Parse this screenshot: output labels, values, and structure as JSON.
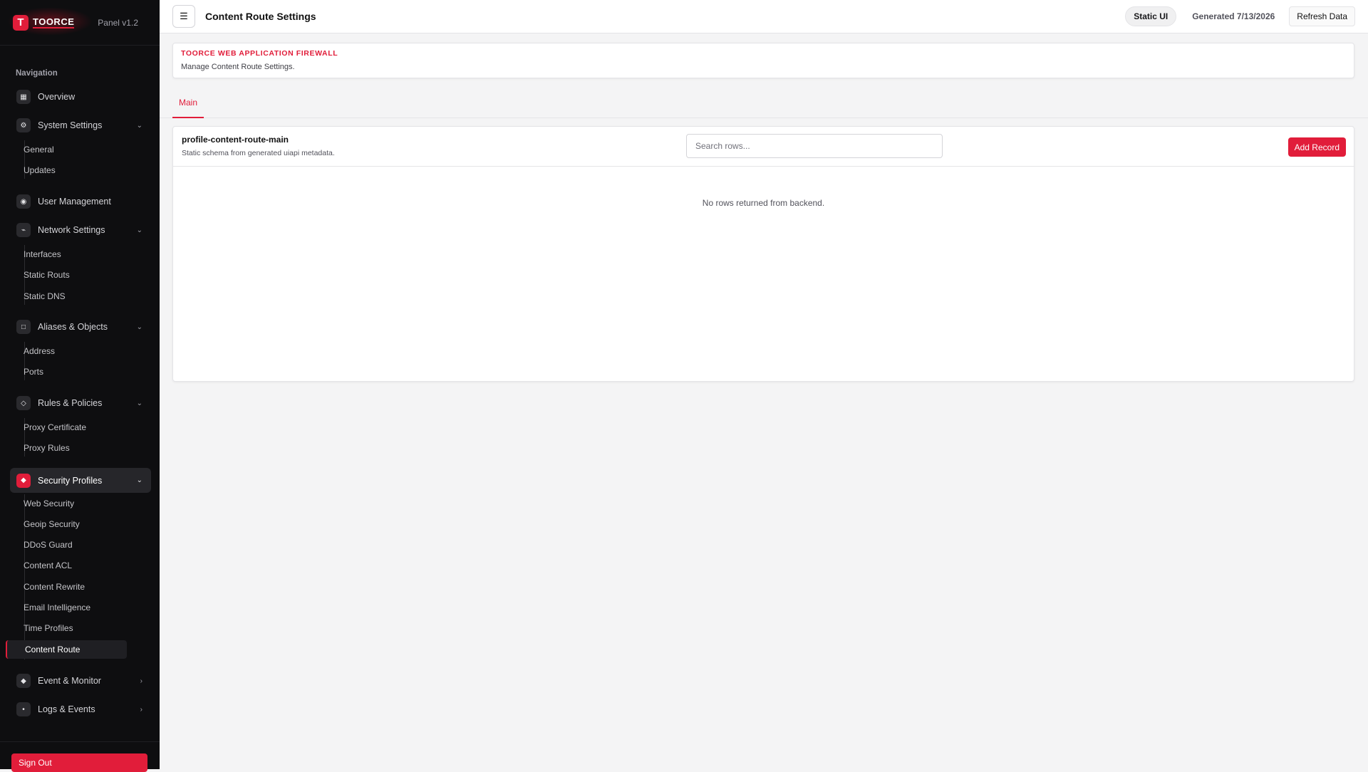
{
  "brand": {
    "logo_letter": "T",
    "name": "TOORCE",
    "version": "Panel v1.2"
  },
  "nav_title": "Navigation",
  "nav": {
    "overview": {
      "label": "Overview",
      "icon": "grid-icon"
    },
    "system_settings": {
      "label": "System Settings",
      "icon": "gear-icon",
      "children": [
        "General",
        "Updates"
      ]
    },
    "user_management": {
      "label": "User Management",
      "icon": "user-icon"
    },
    "network_settings": {
      "label": "Network Settings",
      "icon": "network-icon",
      "children": [
        "Interfaces",
        "Static Routs",
        "Static DNS"
      ]
    },
    "aliases_objects": {
      "label": "Aliases & Objects",
      "icon": "box-icon",
      "children": [
        "Address",
        "Ports"
      ]
    },
    "rules_policies": {
      "label": "Rules & Policies",
      "icon": "diamond-icon",
      "children": [
        "Proxy Certificate",
        "Proxy Rules"
      ]
    },
    "security_profiles": {
      "label": "Security Profiles",
      "icon": "shield-icon",
      "children": [
        "Web Security",
        "Geoip Security",
        "DDoS Guard",
        "Content ACL",
        "Content Rewrite",
        "Email Intelligence",
        "Time Profiles",
        "Content Route"
      ],
      "active_child": "Content Route"
    },
    "event_monitor": {
      "label": "Event & Monitor",
      "icon": "monitor-icon"
    },
    "logs_events": {
      "label": "Logs & Events",
      "icon": "log-icon"
    }
  },
  "sign_out": "Sign Out",
  "topbar": {
    "menu_glyph": "☰",
    "title": "Content Route Settings",
    "pill": "Static UI",
    "generated": "Generated 7/13/2026",
    "refresh": "Refresh Data"
  },
  "header": {
    "title": "TOORCE WEB APPLICATION FIREWALL",
    "subtitle": "Manage Content Route Settings."
  },
  "tabs": [
    "Main"
  ],
  "table": {
    "name": "profile-content-route-main",
    "description": "Static schema from generated uiapi metadata.",
    "search_placeholder": "Search rows...",
    "add_label": "Add Record",
    "empty_text": "No rows returned from backend."
  },
  "colors": {
    "accent": "#e11d3a",
    "sidebar_bg": "#0e0e10"
  }
}
